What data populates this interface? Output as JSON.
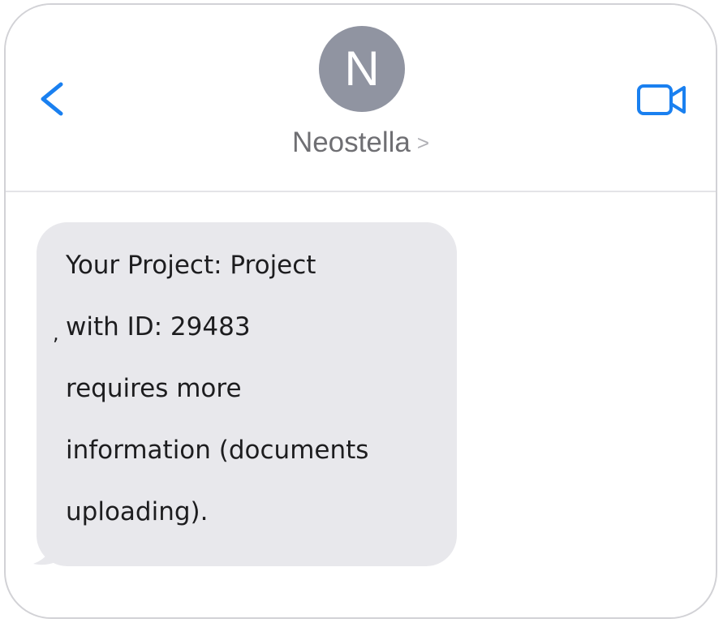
{
  "header": {
    "contact_initial": "N",
    "contact_name": "Neostella",
    "name_chevron": ">",
    "icons": {
      "back": "chevron-left-icon",
      "video": "video-camera-icon"
    },
    "accent_color": "#1a80f0",
    "avatar_color": "#9094a1"
  },
  "messages": [
    {
      "direction": "incoming",
      "lines": [
        "Your Project: Project",
        "with ID: 29483",
        "requires more",
        "information (documents",
        "uploading)."
      ],
      "stray_mark": ","
    }
  ],
  "colors": {
    "bubble_incoming": "#e8e8ec",
    "text_primary": "#1d1d1f",
    "text_secondary": "#6f6f73"
  }
}
